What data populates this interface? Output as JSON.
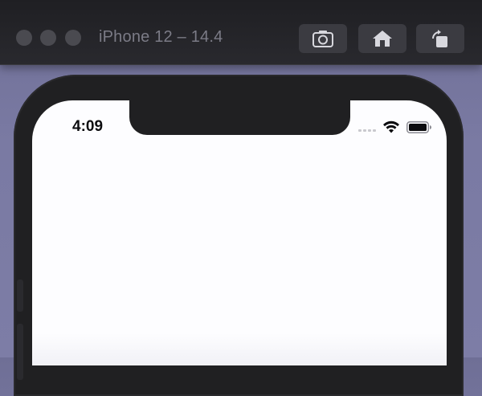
{
  "window": {
    "title": "iPhone 12 – 14.4",
    "toolbar": {
      "screenshot_icon": "camera-icon",
      "home_icon": "home-icon",
      "rotate_icon": "rotate-icon"
    }
  },
  "device": {
    "status_bar": {
      "time": "4:09",
      "signal_icon": "cellular-signal-icon",
      "wifi_icon": "wifi-icon",
      "battery_icon": "battery-icon"
    },
    "screen_background": "#fdfdff",
    "bezel_color": "#202022"
  },
  "colors": {
    "toolbar_bg": "#29292e",
    "desktop_bg": "#7a7aa3",
    "title_text": "#7b7b86"
  }
}
